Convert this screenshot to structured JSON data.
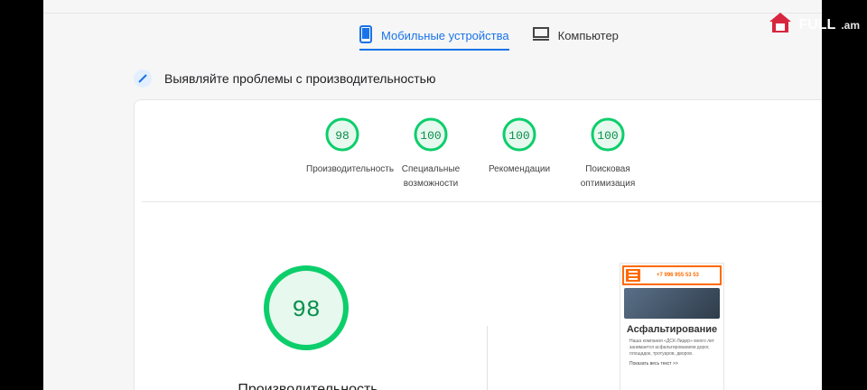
{
  "tabs": [
    {
      "label": "Мобильные устройства"
    },
    {
      "label": "Компьютер"
    }
  ],
  "section": {
    "title": "Выявляйте проблемы с производительностью"
  },
  "scores": [
    {
      "value": "98",
      "label": "Производительность"
    },
    {
      "value": "100",
      "label": "Специальные возможности"
    },
    {
      "value": "100",
      "label": "Рекомендации"
    },
    {
      "value": "100",
      "label": "Поисковая оптимизация"
    }
  ],
  "big_score": {
    "value": "98",
    "title": "Производительность"
  },
  "preview": {
    "phone": "+7 996 955 53 53",
    "heading": "Асфальтирование",
    "text": "Наша компания «ДСК-Лидер» много лет занимается асфальтированием дорог, площадок, тротуаров, дворов.",
    "more": "Показать весь текст >>"
  },
  "brand": {
    "name": "FULL",
    "tld": ".am"
  },
  "colors": {
    "accent": "#1a73e8",
    "pass": "#0cce6b",
    "brand": "#ff6a00"
  }
}
